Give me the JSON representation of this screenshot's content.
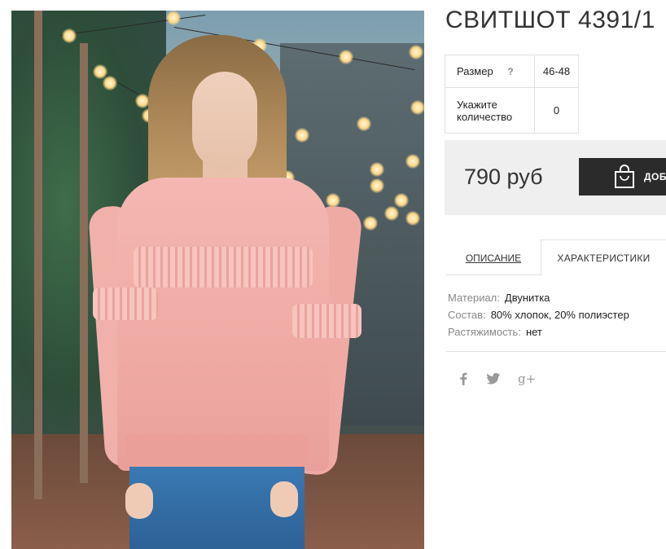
{
  "product": {
    "title": "СВИТШОТ 4391/1",
    "options": {
      "size_label": "Размер",
      "size_help": "?",
      "size_value": "46-48",
      "qty_label_line1": "Укажите",
      "qty_label_line2": "количество",
      "qty_value": "0"
    },
    "price": "790 руб",
    "buy_button_label": "ДОБ"
  },
  "tabs": [
    {
      "label": "ОПИСАНИЕ",
      "active": false
    },
    {
      "label": "ХАРАКТЕРИСТИКИ",
      "active": true
    }
  ],
  "specs": [
    {
      "key": "Материал:",
      "value": "Двунитка"
    },
    {
      "key": "Состав:",
      "value": "80% хлопок, 20% полиэстер"
    },
    {
      "key": "Растяжимость:",
      "value": "нет"
    }
  ],
  "social": [
    {
      "icon": "facebook-icon",
      "glyph": "f"
    },
    {
      "icon": "twitter-icon",
      "glyph": "🐦"
    },
    {
      "icon": "google-plus-icon",
      "glyph": "g+"
    }
  ]
}
